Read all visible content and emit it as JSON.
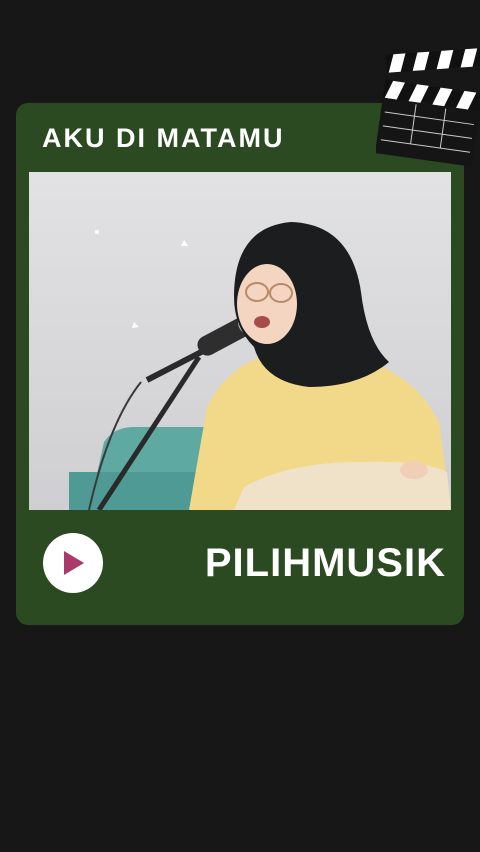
{
  "song": {
    "title": "AKU DI MATAMU"
  },
  "brand": {
    "name": "PILIHMUSIK"
  },
  "player": {
    "play_icon": "play-icon",
    "accent": "#a8396a"
  },
  "colors": {
    "background": "#171717",
    "card": "#2b4a22"
  },
  "decor": {
    "icon": "clapperboard-icon"
  }
}
